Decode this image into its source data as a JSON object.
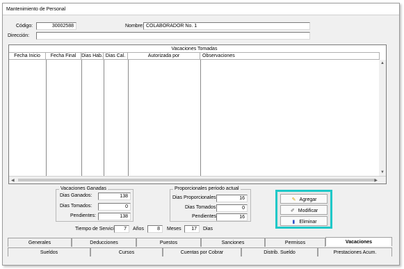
{
  "window": {
    "title": "Mantenimiento de Personal"
  },
  "employee": {
    "codigo_label": "Código:",
    "codigo_value": "30002588",
    "nombre_label": "Nombre:",
    "nombre_value": "COLABORADOR No. 1",
    "direccion_label": "Dirección:",
    "direccion_value": ""
  },
  "grid": {
    "title": "Vacaciones Tomadas",
    "columns": [
      "Fecha Inicio",
      "Fecha Final",
      "Dias Hab.",
      "Dias Cal.",
      "Autorizada por",
      "Observaciones"
    ]
  },
  "vacaciones_ganadas": {
    "title": "Vacaciones Ganadas",
    "dias_ganados_label": "Dias Ganados:",
    "dias_ganados": "138",
    "dias_tomados_label": "Dias Tomados:",
    "dias_tomados": "0",
    "pendientes_label": "Pendientes:",
    "pendientes": "138"
  },
  "proporcionales": {
    "title": "Proporcionales periodo actual",
    "dias_proporcionales_label": "Dias Proporcionales:",
    "dias_proporcionales": "16",
    "dias_tomados_label": "Dias Tomados:",
    "dias_tomados": "0",
    "pendientes_label": "Pendientes:",
    "pendientes": "16"
  },
  "buttons": {
    "agregar": "Agregar",
    "modificar": "Modificar",
    "eliminar": "Eliminar"
  },
  "service": {
    "label": "Tiempo de Servicio:",
    "years": "7",
    "years_label": "Años",
    "months": "8",
    "months_label": "Meses",
    "days": "17",
    "days_label": "Dias"
  },
  "tabs_row1": [
    "Generales",
    "Deducciones",
    "Puestos",
    "Sanciones",
    "Permisos",
    "Vacaciones"
  ],
  "tabs_row2": [
    "Sueldos",
    "Cursos",
    "Cuentas por Cobrar",
    "Distrib. Sueldo",
    "Prestaciones Acum."
  ],
  "active_tab": "Vacaciones",
  "colors": {
    "accent_frame": "#1ec8c8"
  }
}
